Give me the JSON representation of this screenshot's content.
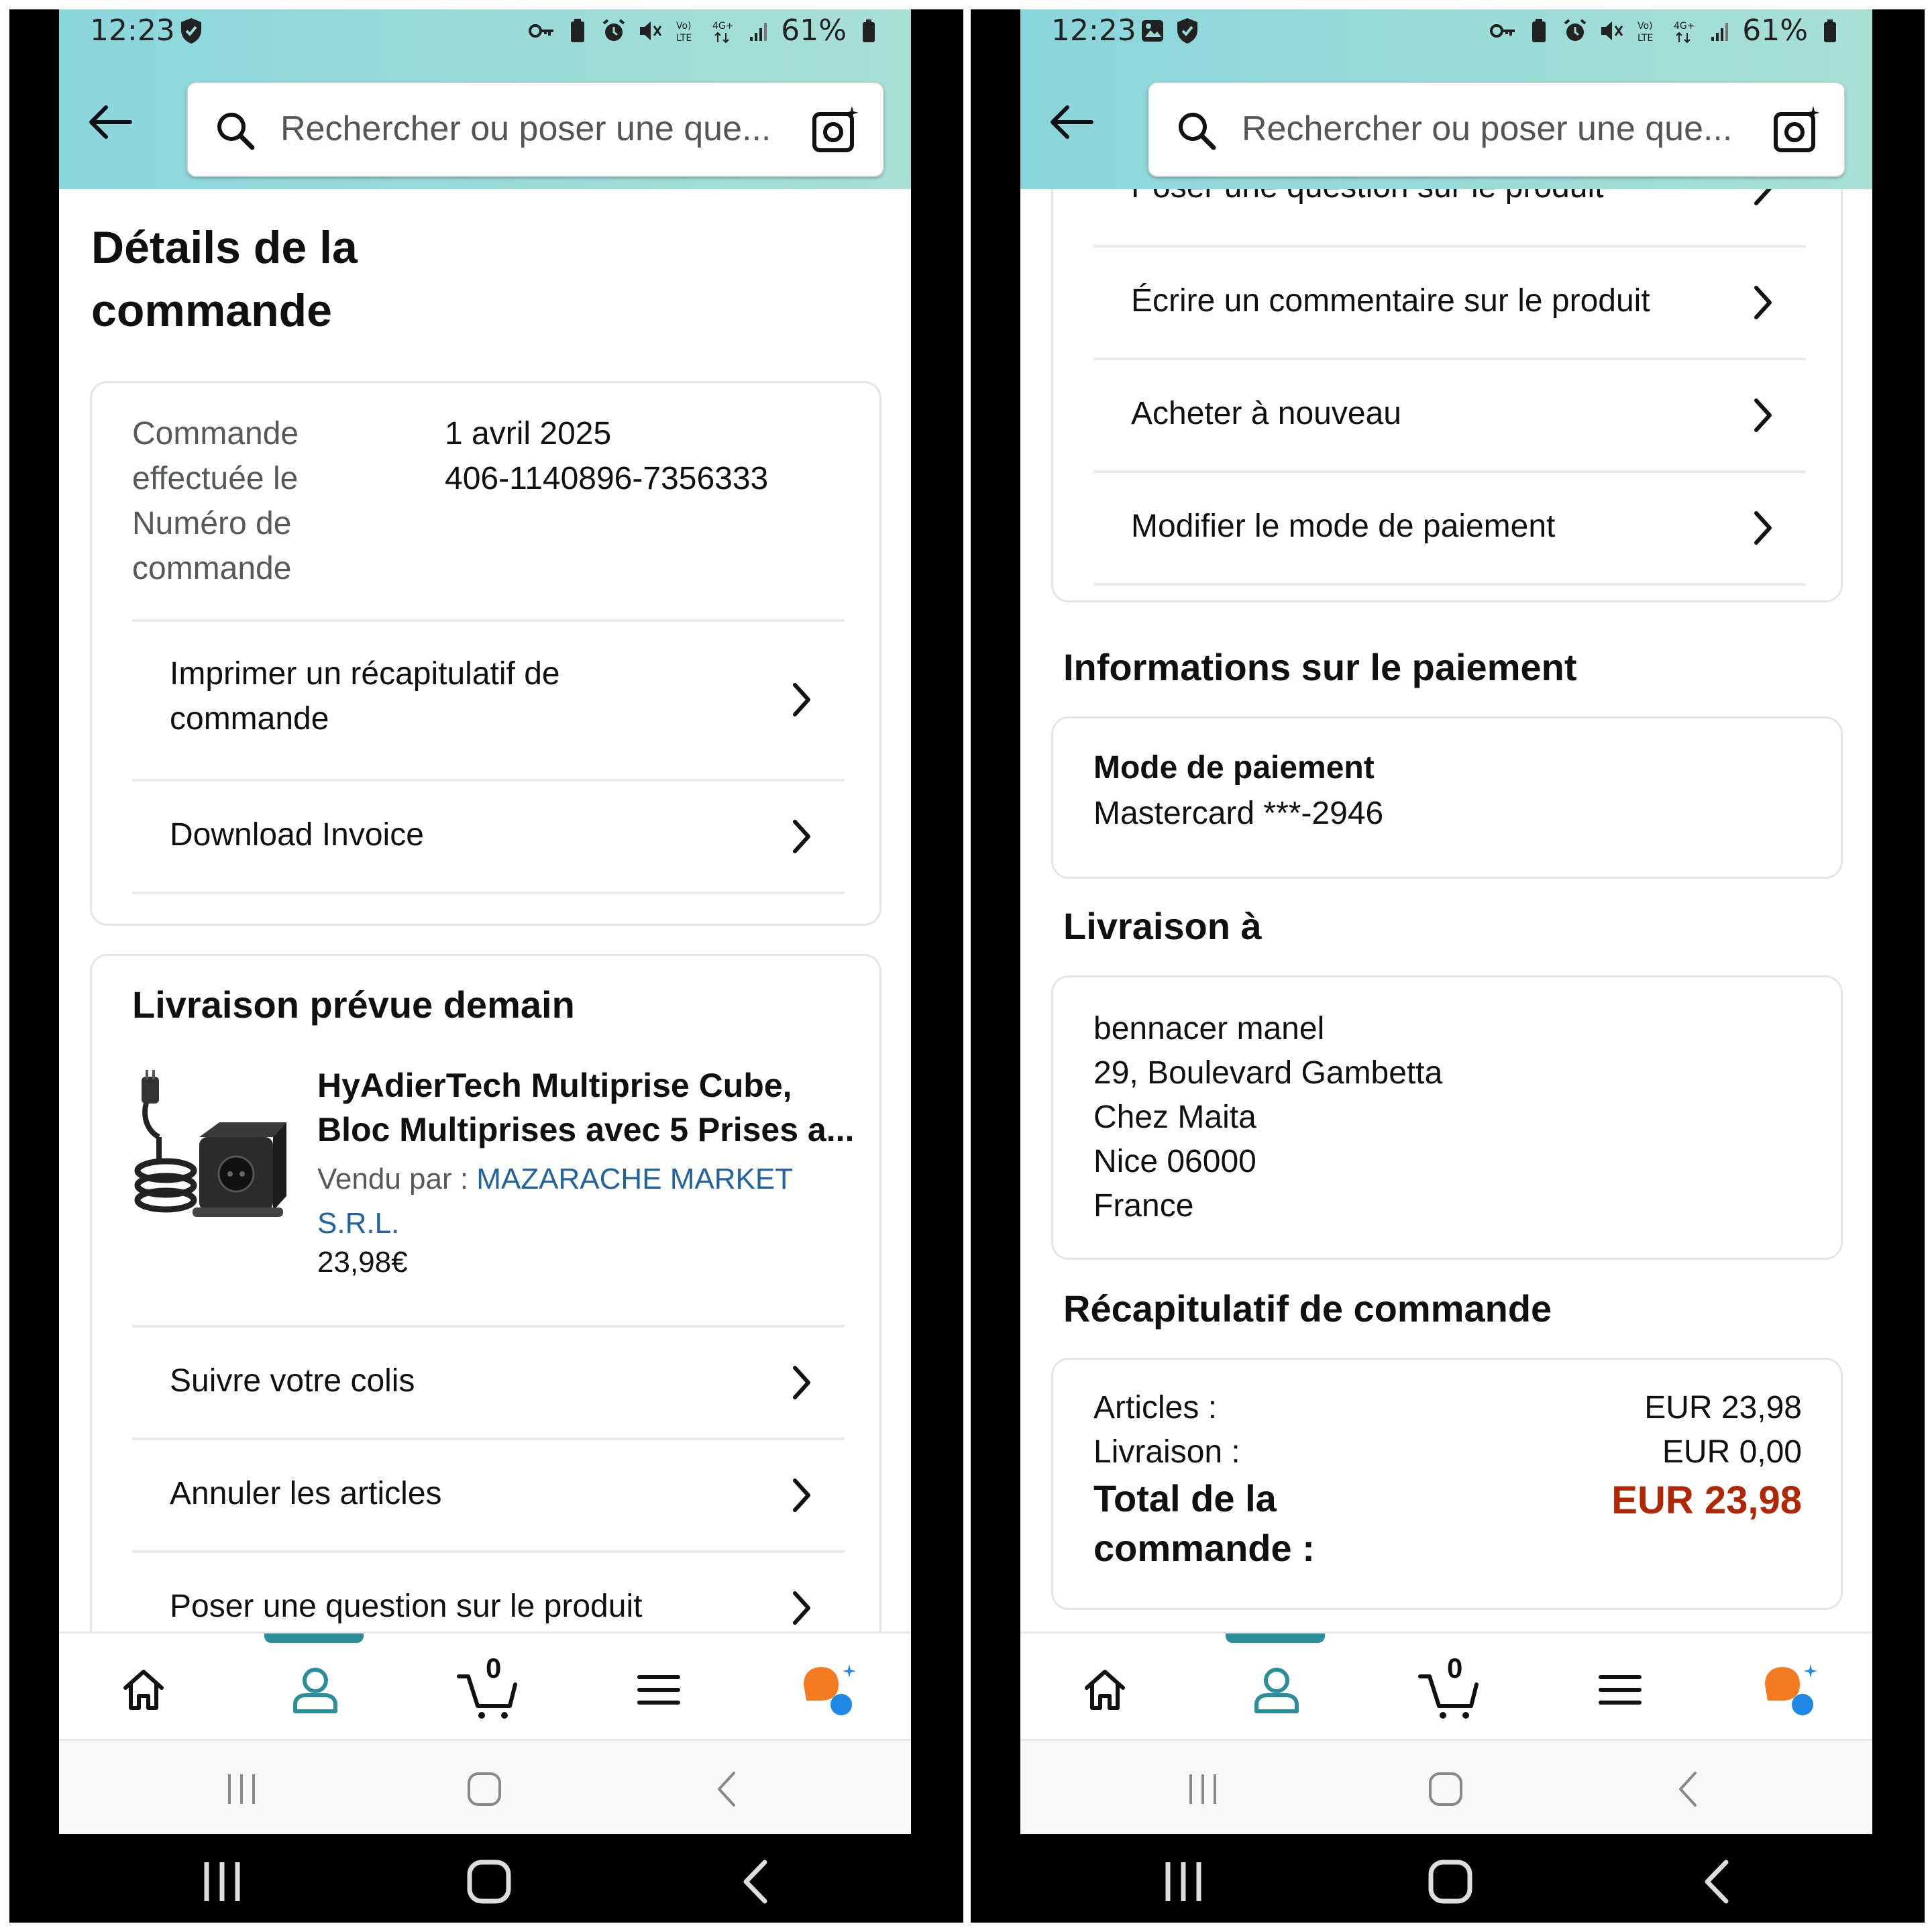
{
  "status": {
    "time": "12:23",
    "battery": "61%"
  },
  "search": {
    "placeholder": "Rechercher ou poser une que..."
  },
  "order": {
    "title_line1": "Détails de la",
    "title_line2": "commande",
    "placed_label_line1": "Commande",
    "placed_label_line2": "effectuée le",
    "number_label_line1": "Numéro de",
    "number_label_line2": "commande",
    "date": "1 avril 2025",
    "number": "406-1140896-7356333",
    "actions": [
      {
        "label_line1": "Imprimer un récapitulatif de",
        "label_line2": "commande"
      },
      {
        "label_line1": "Download Invoice",
        "label_line2": ""
      }
    ]
  },
  "shipment": {
    "heading": "Livraison prévue demain",
    "product_title_line1": "HyAdierTech Multiprise Cube,",
    "product_title_line2": "Bloc Multiprises avec 5 Prises a...",
    "sold_by_label": "Vendu par  : ",
    "seller_line1": "MAZARACHE MARKET",
    "seller_line2": "S.R.L.",
    "price": "23,98€",
    "actions": [
      "Suivre votre colis",
      "Annuler les articles",
      "Poser une question sur le produit",
      "Écrire un commentaire sur le produit",
      "Acheter à nouveau",
      "Modifier le mode de paiement"
    ]
  },
  "payment": {
    "heading": "Informations sur le paiement",
    "method_label": "Mode de paiement",
    "method_value": "Mastercard ***-2946"
  },
  "delivery": {
    "heading": "Livraison à",
    "address": [
      "bennacer manel",
      "29, Boulevard Gambetta",
      "Chez Maita",
      "Nice 06000",
      "France"
    ]
  },
  "summary": {
    "heading": "Récapitulatif de commande",
    "items_label": "Articles :",
    "items_value": "EUR 23,98",
    "shipping_label": "Livraison :",
    "shipping_value": "EUR 0,00",
    "total_label_line1": "Total de la",
    "total_label_line2": "commande :",
    "total_value": "EUR 23,98"
  },
  "nav": {
    "cart_count": "0"
  },
  "colors": {
    "header_gradient_start": "#8ad6dd",
    "header_gradient_end": "#a8e0d4",
    "accent_teal": "#2a8e9b",
    "link_blue": "#2162a1",
    "price_red": "#b12704"
  }
}
